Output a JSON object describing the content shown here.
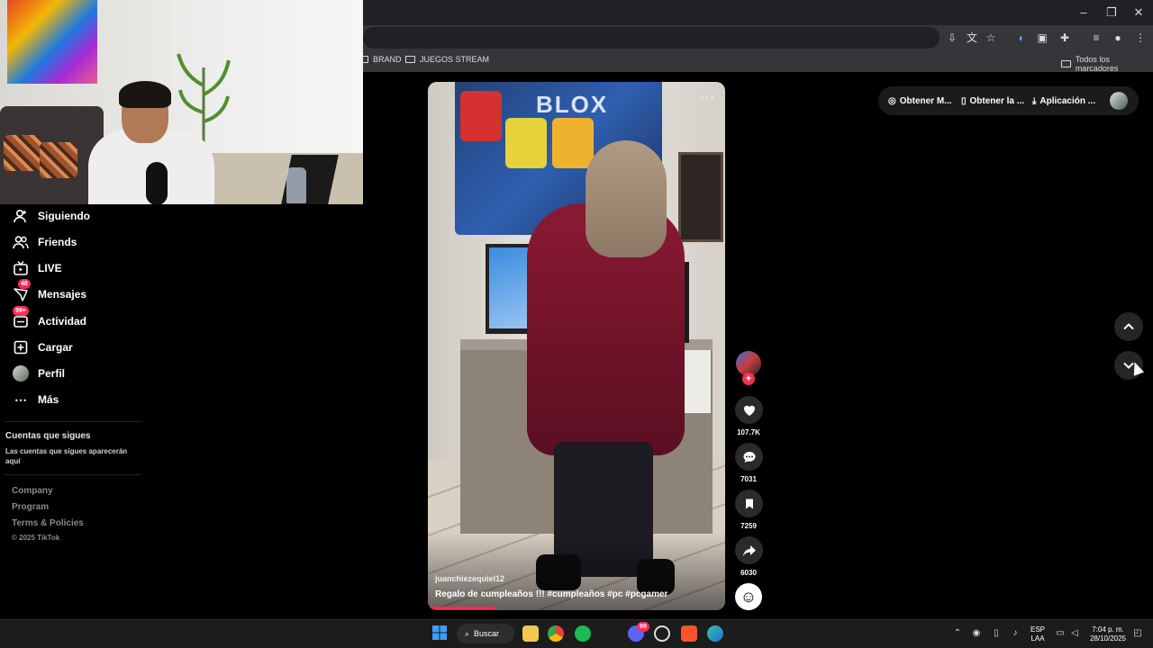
{
  "browser": {
    "bookmarks": [
      {
        "label": "BRAND"
      },
      {
        "label": "JUEGOS STREAM"
      },
      {
        "label": "Todos los marcadores"
      }
    ],
    "window_controls": {
      "minimize": "–",
      "restore": "❐",
      "close": "✕"
    }
  },
  "sidebar": {
    "items": [
      {
        "label": "Siguiendo",
        "icon": "user-plus-icon"
      },
      {
        "label": "Friends",
        "icon": "friends-icon"
      },
      {
        "label": "LIVE",
        "icon": "tv-icon"
      },
      {
        "label": "Mensajes",
        "icon": "message-icon",
        "badge": "48"
      },
      {
        "label": "Actividad",
        "icon": "inbox-icon",
        "badge": "99+"
      },
      {
        "label": "Cargar",
        "icon": "upload-icon"
      },
      {
        "label": "Perfil",
        "icon": "profile-avatar"
      },
      {
        "label": "Más",
        "icon": "more-icon"
      }
    ],
    "following_title": "Cuentas que sigues",
    "following_desc": "Las cuentas que sigues aparecerán aquí",
    "footer_links": [
      "Company",
      "Program",
      "Terms & Policies"
    ],
    "copyright": "© 2025 TikTok"
  },
  "top_actions": {
    "items": [
      {
        "label": "Obtener M...",
        "icon": "coin-icon"
      },
      {
        "label": "Obtener la ...",
        "icon": "phone-icon"
      },
      {
        "label": "Aplicación ...",
        "icon": "download-icon"
      }
    ]
  },
  "video": {
    "banner_text": "BLOX",
    "author": "juanchiezequiel12",
    "caption": "Regalo de cumpleaños !!! #cumpleaños #pc #pcgamer",
    "progress_fraction": 0.23
  },
  "actions": {
    "likes": "107.7K",
    "comments": "7031",
    "saves": "7259",
    "shares": "6030"
  },
  "taskbar": {
    "search_label": "Buscar",
    "discord_badge": "99",
    "lang_top": "ESP",
    "lang_bottom": "LAA",
    "time": "7:04 p. m.",
    "date": "28/10/2025"
  },
  "colors": {
    "accent": "#fe2c55",
    "background": "#000000",
    "chrome": "#35363a"
  }
}
